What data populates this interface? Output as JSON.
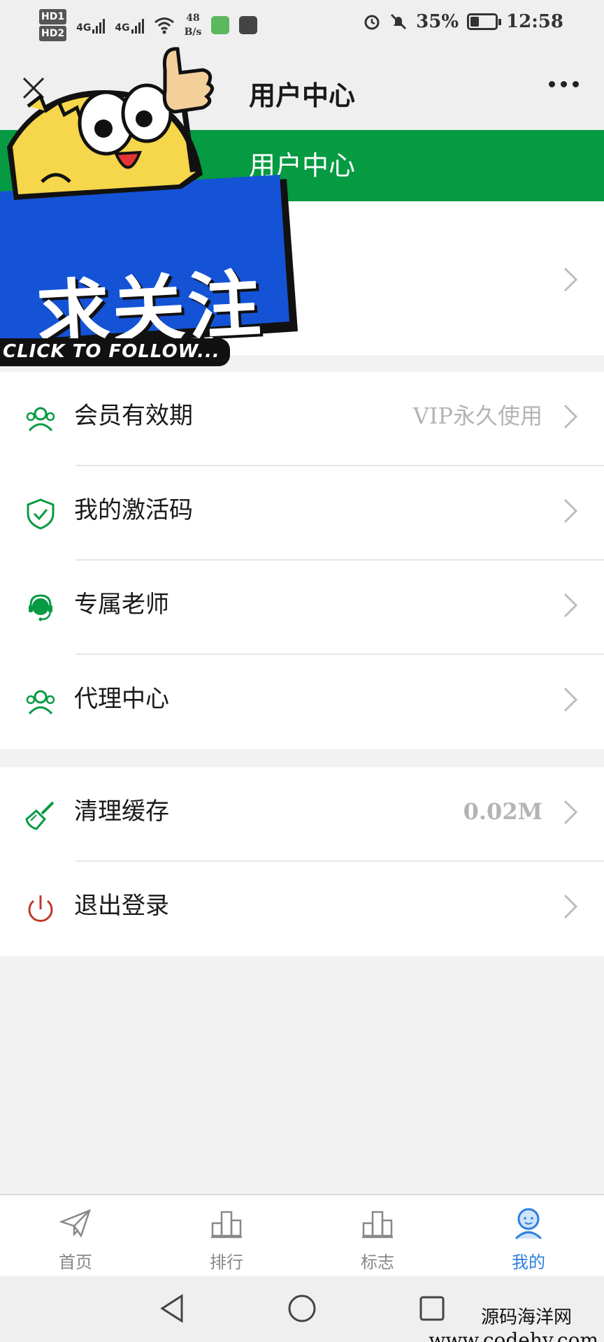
{
  "status_bar": {
    "net_badges": [
      "HD1",
      "HD2"
    ],
    "signal_1": "4G",
    "signal_2": "4G",
    "speed_value": "48",
    "speed_unit": "B/s",
    "battery": "35%",
    "battery_level": 0.35,
    "time": "12:58"
  },
  "nav": {
    "title": "用户中心"
  },
  "header": {
    "title": "用户中心"
  },
  "sticker": {
    "main": "求关注",
    "sub": "CLICK TO FOLLOW..."
  },
  "menu_group_1": [
    {
      "label": "会员有效期",
      "value": "VIP永久使用",
      "icon": "users-icon"
    },
    {
      "label": "我的激活码",
      "value": "",
      "icon": "shield-check-icon"
    },
    {
      "label": "专属老师",
      "value": "",
      "icon": "headset-icon"
    },
    {
      "label": "代理中心",
      "value": "",
      "icon": "users-icon"
    }
  ],
  "menu_group_2": [
    {
      "label": "清理缓存",
      "value": "0.02M",
      "icon": "broom-icon"
    },
    {
      "label": "退出登录",
      "value": "",
      "icon": "power-icon"
    }
  ],
  "tabs": [
    {
      "label": "首页",
      "icon": "paper-plane-icon",
      "active": false
    },
    {
      "label": "排行",
      "icon": "podium-icon",
      "active": false
    },
    {
      "label": "标志",
      "icon": "podium-icon",
      "active": false
    },
    {
      "label": "我的",
      "icon": "person-icon",
      "active": true
    }
  ],
  "watermark": {
    "line1": "源码海洋网",
    "line2": "www.codehy.com"
  },
  "colors": {
    "brand_green": "#069a43",
    "active_blue": "#2d7fe0",
    "logout_red": "#c0392b"
  }
}
